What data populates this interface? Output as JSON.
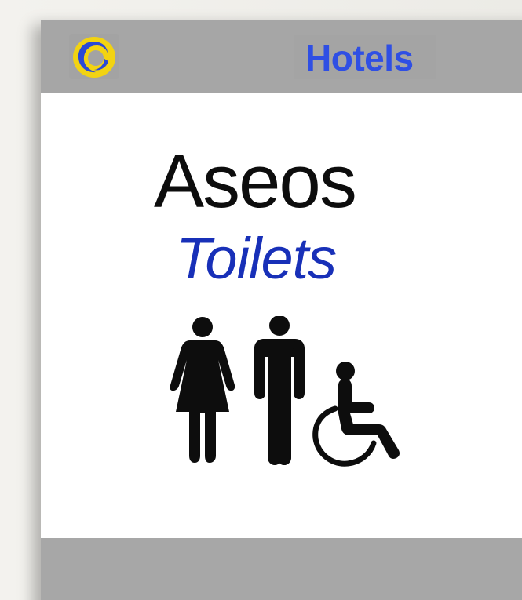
{
  "sign": {
    "brand": "Hotels",
    "title_primary": "Aseos",
    "title_secondary": "Toilets"
  },
  "icons": [
    "logo-ring-icon",
    "woman-icon",
    "man-icon",
    "wheelchair-icon"
  ],
  "colors": {
    "brand_text": "#2f4fe4",
    "title_secondary": "#1830b8",
    "logo_outer": "#f2d312",
    "logo_inner": "#2a49d6",
    "frame_gray": "#a9a9a9",
    "pictogram": "#0d0d0d"
  }
}
